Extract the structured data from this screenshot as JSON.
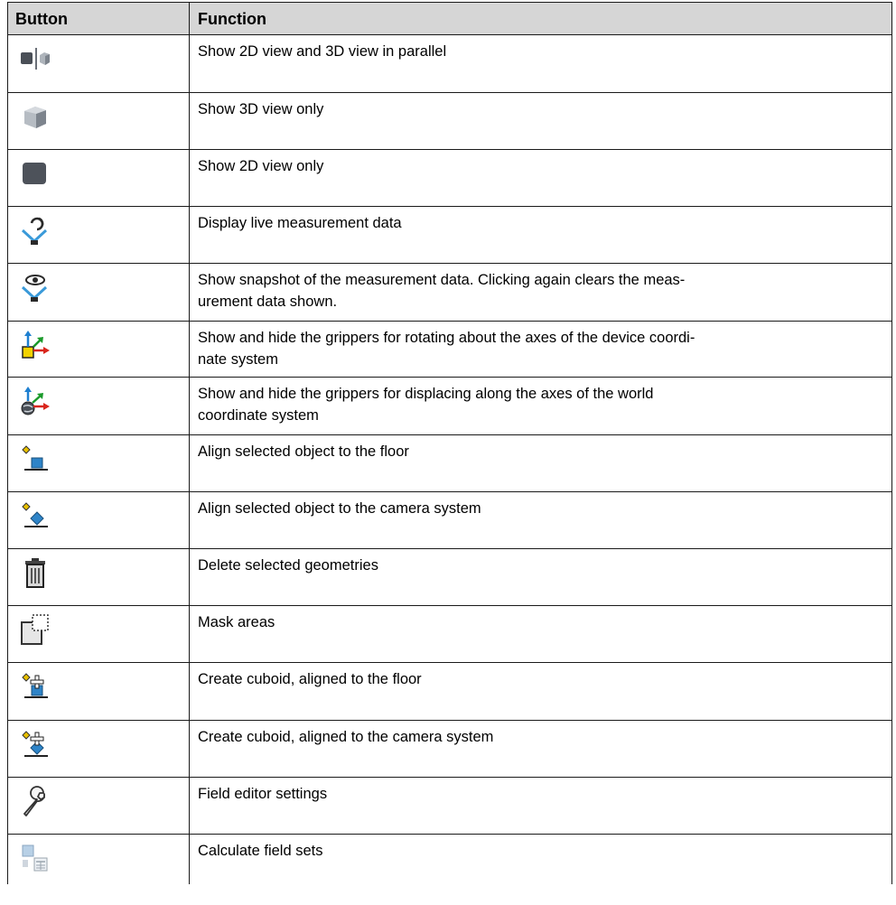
{
  "table": {
    "header": {
      "button": "Button",
      "function": "Function"
    },
    "rows": [
      {
        "icon": "2d-3d-parallel-icon",
        "text": "Show 2D view and 3D view in parallel"
      },
      {
        "icon": "3d-cube-icon",
        "text": "Show 3D view only"
      },
      {
        "icon": "2d-square-icon",
        "text": "Show 2D view only"
      },
      {
        "icon": "live-data-icon",
        "text": "Display live measurement data"
      },
      {
        "icon": "snapshot-eye-icon",
        "text": "Show snapshot of the measurement data. Clicking again clears the meas-",
        "text2": "urement data shown."
      },
      {
        "icon": "rotate-grippers-icon",
        "text": "Show and hide the grippers for rotating about the axes of the device coordi-",
        "text2": "nate system"
      },
      {
        "icon": "displace-grippers-icon",
        "text": "Show and hide the grippers for displacing along the axes of the world",
        "text2": "coordinate system"
      },
      {
        "icon": "align-floor-icon",
        "text": "Align selected object to the floor"
      },
      {
        "icon": "align-camera-icon",
        "text": "Align selected object to the camera system"
      },
      {
        "icon": "trash-icon",
        "text": "Delete selected geometries"
      },
      {
        "icon": "mask-areas-icon",
        "text": "Mask areas"
      },
      {
        "icon": "cuboid-floor-icon",
        "text": "Create cuboid, aligned to the floor"
      },
      {
        "icon": "cuboid-camera-icon",
        "text": "Create cuboid, aligned to the camera system"
      },
      {
        "icon": "wrench-icon",
        "text": "Field editor settings"
      },
      {
        "icon": "calculator-icon",
        "text": "Calculate field sets"
      }
    ]
  }
}
